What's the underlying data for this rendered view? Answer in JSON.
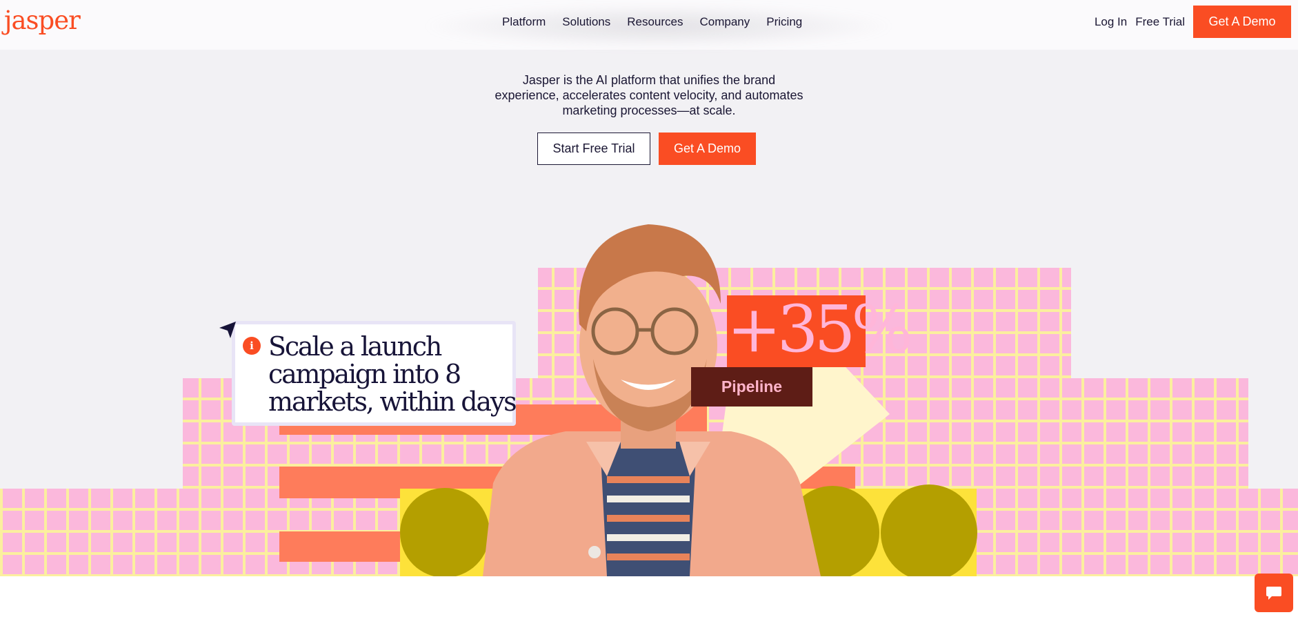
{
  "header": {
    "logo": "jasper",
    "nav": [
      "Platform",
      "Solutions",
      "Resources",
      "Company",
      "Pricing"
    ],
    "log_in": "Log In",
    "free_trial": "Free Trial",
    "get_demo": "Get A Demo"
  },
  "hero": {
    "lines": [
      "Jasper is the AI platform that unifies the brand",
      "experience, accelerates content velocity, and automates",
      "marketing processes—at scale."
    ],
    "primary_cta": "Start Free Trial",
    "secondary_cta": "Get A Demo"
  },
  "illustration": {
    "card_text": "Scale a launch campaign into 8 markets, within days",
    "card_icon": "i",
    "stat_value": "+35%",
    "stat_label": "Pipeline"
  },
  "colors": {
    "accent": "#fa4d23",
    "navy": "#1a1633",
    "pink": "#fbb8dc",
    "yellow": "#fde23a",
    "olive": "#b49f00",
    "salmon": "#fe7c5b"
  },
  "icons": {
    "cursor": "pointer-arrow-icon",
    "chat": "chat-bubble-icon"
  }
}
